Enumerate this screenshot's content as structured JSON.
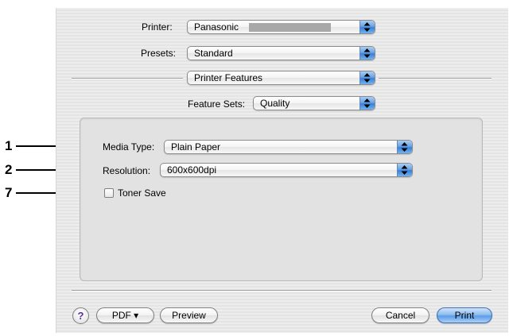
{
  "printer": {
    "label": "Printer:",
    "value": "Panasonic"
  },
  "presets": {
    "label": "Presets:",
    "value": "Standard"
  },
  "panel_selector": {
    "value": "Printer Features"
  },
  "feature_sets": {
    "label": "Feature Sets:",
    "value": "Quality"
  },
  "media_type": {
    "label": "Media Type:",
    "value": "Plain Paper"
  },
  "resolution": {
    "label": "Resolution:",
    "value": "600x600dpi"
  },
  "toner_save": {
    "label": "Toner Save",
    "checked": false
  },
  "callouts": [
    "1",
    "2",
    "7"
  ],
  "buttons": {
    "help": "?",
    "pdf": "PDF ▾",
    "preview": "Preview",
    "cancel": "Cancel",
    "print": "Print"
  },
  "colors": {
    "accent": "#4a8fe0",
    "dialog_background": "#e8e8e8"
  },
  "icons": {
    "popup_arrows": "up-down-arrows-icon",
    "help": "question-mark-icon"
  }
}
